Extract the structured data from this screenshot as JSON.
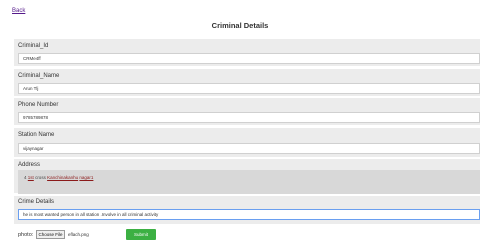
{
  "back_link": "Back",
  "page_title": "Criminal Details",
  "fields": {
    "criminal_id": {
      "label": "Criminal_Id",
      "value": "CRMe4ff"
    },
    "criminal_name": {
      "label": "Criminal_Name",
      "value": "Arun Tlj"
    },
    "phone_number": {
      "label": "Phone Number",
      "value": "9785789878"
    },
    "station_name": {
      "label": "Station Name",
      "value": "vijaynagar"
    },
    "address": {
      "label": "Address",
      "prefix": "4",
      "part1": "1st",
      "part2": "cross",
      "part3": "Kanchinakanhu",
      "part4": "nagar1"
    },
    "crime_details": {
      "label": "Crime Details",
      "value": "he is most wanted person in all station .Involve in all criminal activity"
    }
  },
  "photo": {
    "label": "photo:",
    "choose_button": "Choose File",
    "file_name": "eflach.png"
  },
  "submit_label": "Submit"
}
